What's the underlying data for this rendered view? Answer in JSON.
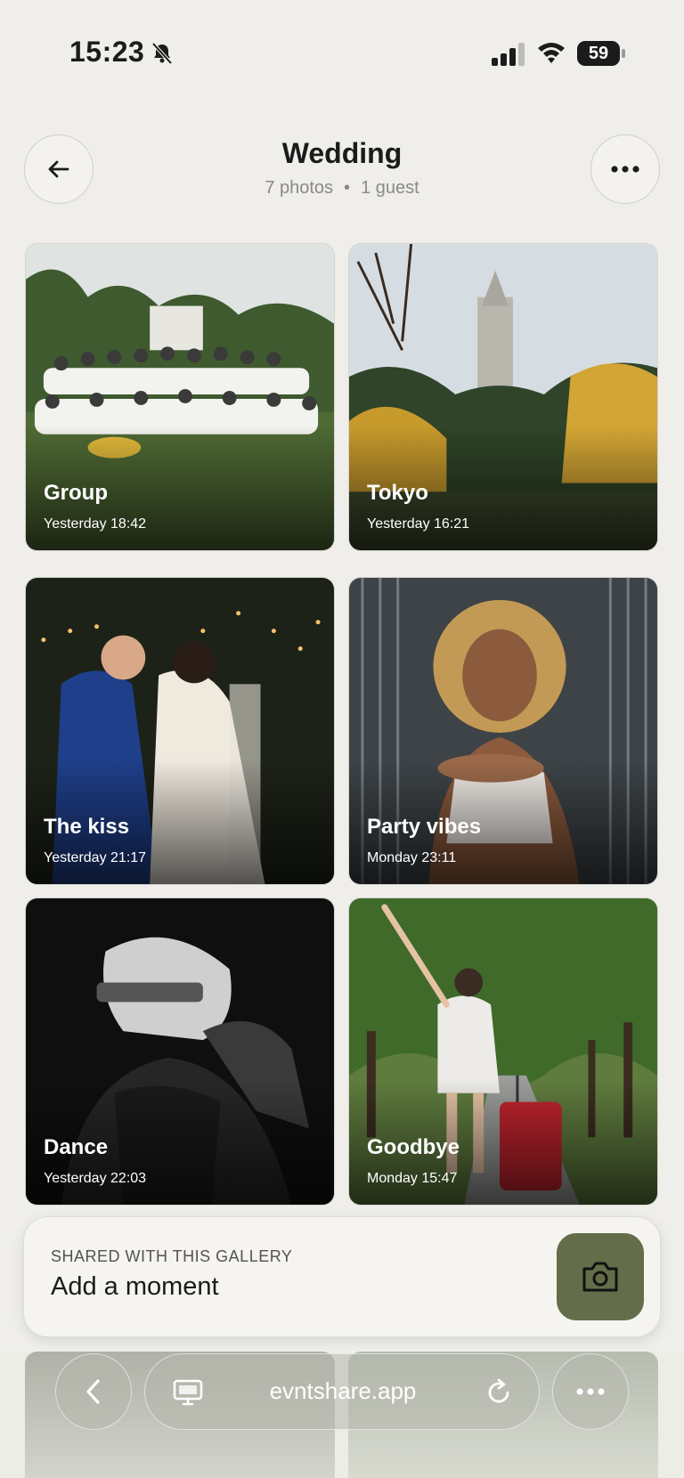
{
  "status_bar": {
    "time": "15:23",
    "battery": "59",
    "icons": [
      "bell-slash-icon",
      "signal-icon",
      "wifi-icon",
      "battery-icon"
    ]
  },
  "header": {
    "title": "Wedding",
    "photo_count": "7 photos",
    "separator": "•",
    "guest_count": "1 guest",
    "back_icon": "arrow-left-icon",
    "more_icon": "ellipsis-icon"
  },
  "photos": [
    {
      "title": "Group",
      "time": "Yesterday 18:42"
    },
    {
      "title": "Tokyo",
      "time": "Yesterday 16:21"
    },
    {
      "title": "The kiss",
      "time": "Yesterday 21:17"
    },
    {
      "title": "Party vibes",
      "time": "Monday 23:11"
    },
    {
      "title": "Dance",
      "time": "Yesterday 22:03"
    },
    {
      "title": "Goodbye",
      "time": "Monday 15:47"
    }
  ],
  "moment_panel": {
    "eyebrow": "SHARED WITH THIS GALLERY",
    "title": "Add a moment",
    "button_icon": "camera-icon"
  },
  "browser_bar": {
    "url": "evntshare.app",
    "icons": [
      "chevron-left-icon",
      "monitor-icon",
      "reload-icon",
      "ellipsis-icon"
    ]
  },
  "colors": {
    "background": "#efeeea",
    "accent": "#646d49",
    "text": "#1b1b1b",
    "muted": "#8c8a85"
  }
}
